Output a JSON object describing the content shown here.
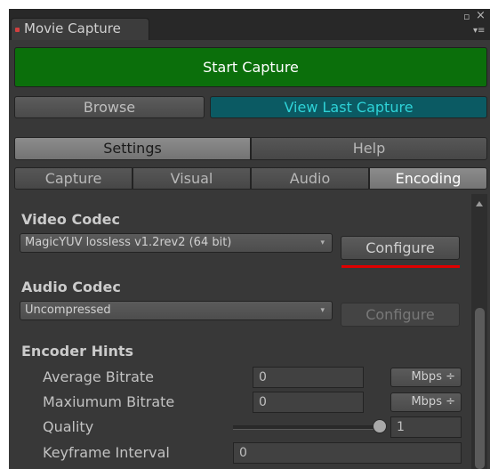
{
  "window": {
    "tab_title": "Movie Capture",
    "close_icon": "×",
    "maximize_icon": "▫",
    "menu_icon": "▾≡"
  },
  "actions": {
    "start_capture": "Start Capture",
    "browse": "Browse",
    "view_last_capture": "View Last Capture"
  },
  "main_tabs": [
    "Settings",
    "Help"
  ],
  "sub_tabs": [
    "Capture",
    "Visual",
    "Audio",
    "Encoding"
  ],
  "active_sub_tab": "Encoding",
  "encoding": {
    "video_codec": {
      "heading": "Video Codec",
      "selected": "MagicYUV lossless v1.2rev2 (64 bit)",
      "configure_label": "Configure"
    },
    "audio_codec": {
      "heading": "Audio Codec",
      "selected": "Uncompressed",
      "configure_label": "Configure"
    },
    "hints": {
      "heading": "Encoder Hints",
      "average_bitrate": {
        "label": "Average Bitrate",
        "value": "0",
        "unit": "Mbps ÷"
      },
      "maximum_bitrate": {
        "label": "Maxiumum Bitrate",
        "value": "0",
        "unit": "Mbps ÷"
      },
      "quality": {
        "label": "Quality",
        "value": "1",
        "slider_fraction": 1.0
      },
      "keyframe_interval": {
        "label": "Keyframe Interval",
        "value": "0"
      }
    }
  },
  "colors": {
    "start_button": "#0b6f0b",
    "view_last_button": "#0b5a63",
    "view_last_text": "#2ed3d8",
    "highlight_underline": "#e00000"
  }
}
